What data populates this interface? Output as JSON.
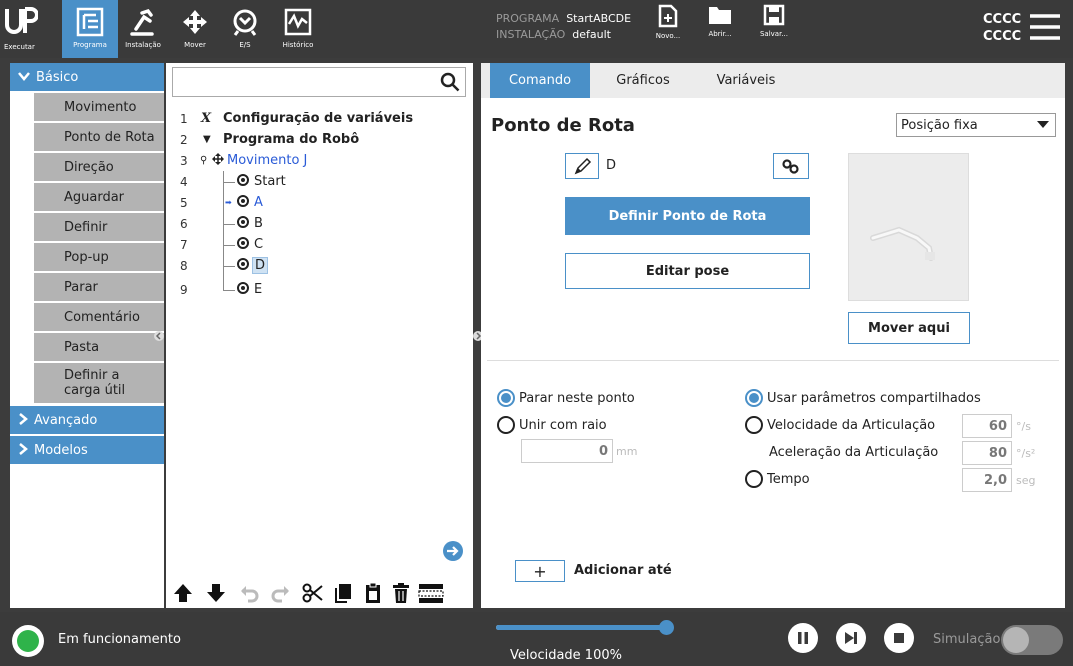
{
  "topbar": {
    "nav": [
      {
        "label": "Executar",
        "icon": "run-icon"
      },
      {
        "label": "Programa",
        "icon": "program-icon",
        "active": true
      },
      {
        "label": "Instalação",
        "icon": "installation-icon"
      },
      {
        "label": "Mover",
        "icon": "move-icon"
      },
      {
        "label": "E/S",
        "icon": "io-icon"
      },
      {
        "label": "Histórico",
        "icon": "log-icon"
      }
    ],
    "program_label": "PROGRAMA",
    "program_value": "StartABCDE",
    "installation_label": "INSTALAÇÃO",
    "installation_value": "default",
    "file_buttons": [
      {
        "label": "Novo...",
        "icon": "new-file-icon"
      },
      {
        "label": "Abrir...",
        "icon": "folder-icon"
      },
      {
        "label": "Salvar...",
        "icon": "save-icon"
      }
    ],
    "user_line1": "CCCC",
    "user_line2": "CCCC"
  },
  "sidebar": {
    "categories": [
      {
        "label": "Básico",
        "expanded": true
      },
      {
        "label": "Avançado",
        "expanded": false
      },
      {
        "label": "Modelos",
        "expanded": false
      }
    ],
    "basic_items": [
      {
        "label": "Movimento"
      },
      {
        "label": "Ponto de Rota"
      },
      {
        "label": "Direção"
      },
      {
        "label": "Aguardar"
      },
      {
        "label": "Definir"
      },
      {
        "label": "Pop-up"
      },
      {
        "label": "Parar"
      },
      {
        "label": "Comentário"
      },
      {
        "label": "Pasta"
      },
      {
        "label": "Definir a\ncarga útil"
      }
    ]
  },
  "tree": {
    "search_value": "",
    "rows": [
      {
        "num": "1",
        "text": "Configuração de variáveis",
        "icon": "variable-x-icon"
      },
      {
        "num": "2",
        "text": "Programa do Robô",
        "icon": "triangle-down-icon"
      },
      {
        "num": "3",
        "text": "Movimento J",
        "icon": "move-icon"
      },
      {
        "num": "4",
        "text": "Start",
        "icon": "waypoint-icon"
      },
      {
        "num": "5",
        "text": "A",
        "icon": "waypoint-icon"
      },
      {
        "num": "6",
        "text": "B",
        "icon": "waypoint-icon"
      },
      {
        "num": "7",
        "text": "C",
        "icon": "waypoint-icon"
      },
      {
        "num": "8",
        "text": "D",
        "icon": "waypoint-icon"
      },
      {
        "num": "9",
        "text": "E",
        "icon": "waypoint-icon"
      }
    ],
    "toolbar": [
      "up-arrow-icon",
      "down-arrow-icon",
      "undo-icon",
      "redo-icon",
      "cut-icon",
      "copy-icon",
      "paste-icon",
      "delete-icon",
      "suppress-icon"
    ]
  },
  "command": {
    "tabs": [
      {
        "label": "Comando",
        "active": true
      },
      {
        "label": "Gráficos"
      },
      {
        "label": "Variáveis"
      }
    ],
    "title": "Ponto de Rota",
    "position_type": "Posição fixa",
    "waypoint_name": "D",
    "define_button": "Definir Ponto de Rota",
    "edit_button": "Editar pose",
    "move_here_button": "Mover aqui",
    "stop_at_point": "Parar neste ponto",
    "blend_radius": "Unir com raio",
    "blend_value": "0",
    "blend_unit": "mm",
    "shared_params": "Usar parâmetros compartilhados",
    "joint_speed": "Velocidade da Articulação",
    "joint_speed_value": "60",
    "joint_speed_unit": "°/s",
    "joint_accel": "Aceleração da Articulação",
    "joint_accel_value": "80",
    "joint_accel_unit": "°/s²",
    "time": "Tempo",
    "time_value": "2,0",
    "time_unit": "seg",
    "add_until_symbol": "+",
    "add_until": "Adicionar até"
  },
  "footer": {
    "status": "Em funcionamento",
    "speed_label": "Velocidade 100%",
    "speed_fraction": 1.0,
    "simulation_label": "Simulação",
    "simulation_on": false
  },
  "colors": {
    "accent": "#4a90c8",
    "topbar": "#3a3a3a",
    "status_green": "#2fb34a"
  }
}
